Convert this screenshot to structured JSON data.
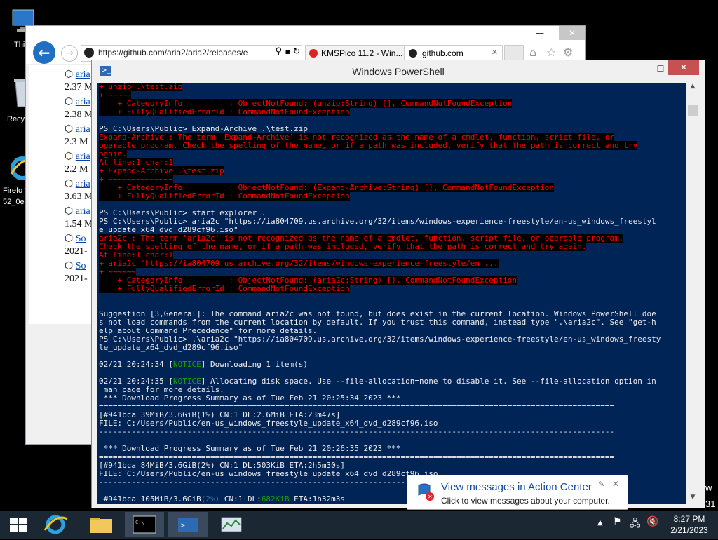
{
  "desktop": {
    "icons": [
      {
        "label": "Thi"
      },
      {
        "label": "Recyc"
      },
      {
        "label": "Firefo"
      },
      {
        "label": "52_0es"
      }
    ],
    "edge_chars": {
      "w": "w",
      "one": "31"
    }
  },
  "ie": {
    "address": "https://github.com/aria2/aria2/releases/e",
    "tabs": [
      {
        "title": "KMSPico 11.2 - Win..."
      },
      {
        "title": "github.com"
      }
    ],
    "downloads": [
      {
        "name": "aria",
        "meta": "2.37 M"
      },
      {
        "name": "aria",
        "meta": "2.38 M"
      },
      {
        "name": "aria",
        "meta": "2.3 M"
      },
      {
        "name": "aria",
        "meta": "2.2 M"
      },
      {
        "name": "aria",
        "meta": "3.63 M"
      },
      {
        "name": "aria",
        "meta": "1.54 M"
      },
      {
        "name": "So",
        "meta": "2021-"
      },
      {
        "name": "So",
        "meta": "2021-"
      }
    ]
  },
  "powershell": {
    "title": "Windows PowerShell",
    "lines": [
      {
        "t": "+ unzip .\\test.zip",
        "c": "err"
      },
      {
        "t": "+ ~~~~~",
        "c": "err"
      },
      {
        "t": "    + CategoryInfo          : ObjectNotFound: (unzip:String) [], CommandNotFoundException",
        "c": "err"
      },
      {
        "t": "    + FullyQualifiedErrorId : CommandNotFoundException",
        "c": "err"
      },
      {
        "t": "",
        "c": ""
      },
      {
        "t": "PS C:\\Users\\Public> Expand-Archive .\\test.zip",
        "c": ""
      },
      {
        "t": "Expand-Archive : The term 'Expand-Archive' is not recognized as the name of a cmdlet, function, script file, or",
        "c": "err"
      },
      {
        "t": "operable program. Check the spelling of the name, or if a path was included, verify that the path is correct and try",
        "c": "err"
      },
      {
        "t": "again.",
        "c": "err"
      },
      {
        "t": "At line:1 char:1",
        "c": "err"
      },
      {
        "t": "+ Expand-Archive .\\test.zip",
        "c": "err"
      },
      {
        "t": "+ ~~~~~~~~~~~~~~",
        "c": "err"
      },
      {
        "t": "    + CategoryInfo          : ObjectNotFound: (Expand-Archive:String) [], CommandNotFoundException",
        "c": "err"
      },
      {
        "t": "    + FullyQualifiedErrorId : CommandNotFoundException",
        "c": "err"
      },
      {
        "t": "",
        "c": ""
      },
      {
        "t": "PS C:\\Users\\Public> start explorer .",
        "c": ""
      },
      {
        "t": "PS C:\\Users\\Public> aria2c \"https://ia804709.us.archive.org/32/items/windows-experience-freestyle/en-us_windows_freestyl",
        "c": ""
      },
      {
        "t": "e_update_x64_dvd_d289cf96.iso\"",
        "c": ""
      },
      {
        "t": "aria2c : The term 'aria2c' is not recognized as the name of a cmdlet, function, script file, or operable program.",
        "c": "err"
      },
      {
        "t": "Check the spelling of the name, or if a path was included, verify that the path is correct and try again.",
        "c": "err"
      },
      {
        "t": "At line:1 char:1",
        "c": "err"
      },
      {
        "t": "+ aria2c \"https://ia804709.us.archive.org/32/items/windows-experience-freestyle/en ...",
        "c": "err"
      },
      {
        "t": "+ ~~~~~~",
        "c": "err"
      },
      {
        "t": "    + CategoryInfo          : ObjectNotFound: (aria2c:String) [], CommandNotFoundException",
        "c": "err"
      },
      {
        "t": "    + FullyQualifiedErrorId : CommandNotFoundException",
        "c": "err"
      },
      {
        "t": "",
        "c": ""
      },
      {
        "t": "",
        "c": ""
      },
      {
        "t": "Suggestion [3,General]: The command aria2c was not found, but does exist in the current location. Windows PowerShell doe",
        "c": ""
      },
      {
        "t": "s not load commands from the current location by default. If you trust this command, instead type \".\\aria2c\". See \"get-h",
        "c": ""
      },
      {
        "t": "elp about_Command_Precedence\" for more details.",
        "c": ""
      },
      {
        "t": "PS C:\\Users\\Public> .\\aria2c \"https://ia804709.us.archive.org/32/items/windows-experience-freestyle/en-us_windows_freesty",
        "c": ""
      },
      {
        "t": "le_update_x64_dvd_d289cf96.iso\"",
        "c": ""
      },
      {
        "t": "",
        "c": ""
      },
      {
        "t": "02/21 20:24:34 [NOTICE] Downloading 1 item(s)",
        "c": "notice"
      },
      {
        "t": "",
        "c": ""
      },
      {
        "t": "02/21 20:24:35 [NOTICE] Allocating disk space. Use --file-allocation=none to disable it. See --file-allocation option in",
        "c": "notice"
      },
      {
        "t": " man page for more details.",
        "c": ""
      },
      {
        "t": " *** Download Progress Summary as of Tue Feb 21 20:25:34 2023 ***",
        "c": ""
      },
      {
        "t": "===============================================================================================================",
        "c": ""
      },
      {
        "t": "[#941bca 39MiB/3.6GiB(1%) CN:1 DL:2.6MiB ETA:23m47s]",
        "c": ""
      },
      {
        "t": "FILE: C:/Users/Public/en-us_windows_freestyle_update_x64_dvd_d289cf96.iso",
        "c": ""
      },
      {
        "t": "---------------------------------------------------------------------------------------------------------------",
        "c": ""
      },
      {
        "t": "",
        "c": ""
      },
      {
        "t": " *** Download Progress Summary as of Tue Feb 21 20:26:35 2023 ***",
        "c": ""
      },
      {
        "t": "===============================================================================================================",
        "c": ""
      },
      {
        "t": "[#941bca 84MiB/3.6GiB(2%) CN:1 DL:503KiB ETA:2h5m30s]",
        "c": ""
      },
      {
        "t": "FILE: C:/Users/Public/en-us_windows_freestyle_update_x64_dvd_d289cf96.iso",
        "c": ""
      },
      {
        "t": "---------------------------------------------------------------------------------------------------------------",
        "c": ""
      },
      {
        "t": "",
        "c": ""
      },
      {
        "t": " #941bca 105MiB/3.6GiB(2%) CN:1 DL:682KiB ETA:1h32m3s",
        "c": ""
      }
    ]
  },
  "toast": {
    "title": "View messages in Action Center",
    "body": "Click to view messages about your computer."
  },
  "taskbar": {
    "time": "8:27 PM",
    "date": "2/21/2023"
  },
  "colors": {
    "console_bg": "#012456",
    "taskbar_bg": "#1b2733",
    "close_red": "#c75050"
  }
}
